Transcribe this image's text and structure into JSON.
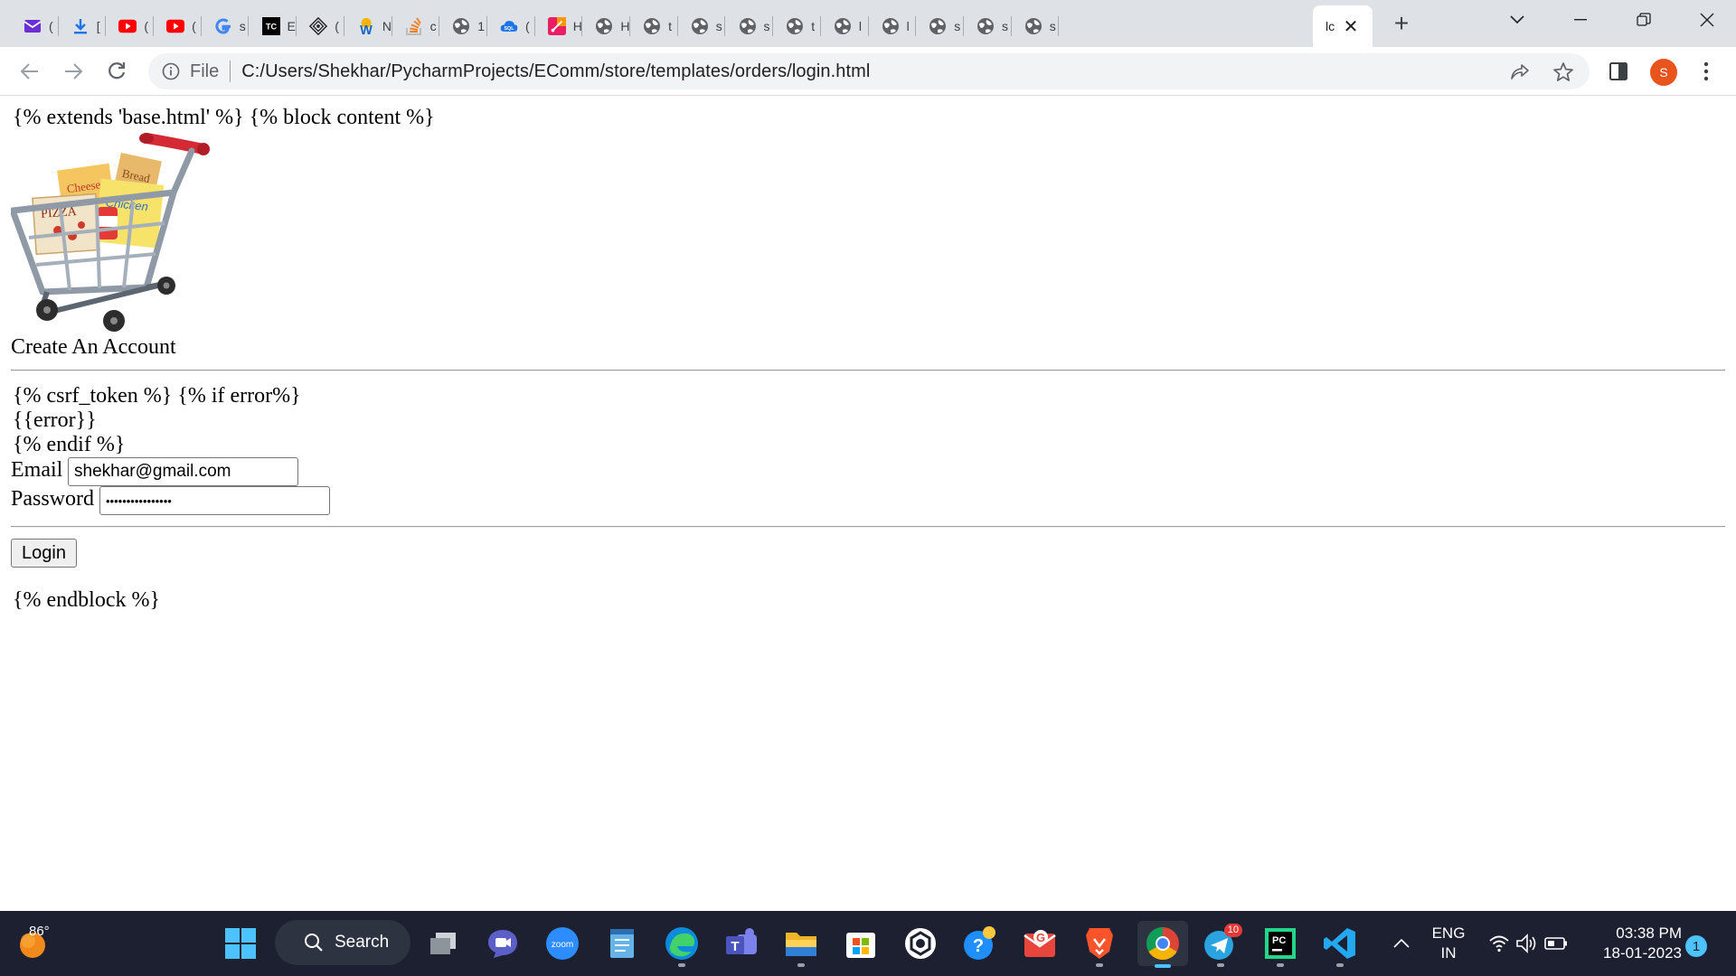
{
  "browser": {
    "tabs": [
      {
        "icon": "gmail-icon",
        "letter": "(",
        "color": "#6b2fd3"
      },
      {
        "icon": "download-icon",
        "letter": "[",
        "color": "#1a73e8"
      },
      {
        "icon": "youtube-icon",
        "letter": "(",
        "color": "#ff0000"
      },
      {
        "icon": "youtube-icon",
        "letter": "(",
        "color": "#ff0000"
      },
      {
        "icon": "google-icon",
        "letter": "s",
        "color": "#4285f4"
      },
      {
        "icon": "tc-icon",
        "letter": "E",
        "color": "#000000"
      },
      {
        "icon": "compass-icon",
        "letter": "(",
        "color": "#202124"
      },
      {
        "icon": "w-icon",
        "letter": "N",
        "color": "#f4b400"
      },
      {
        "icon": "stack-icon",
        "letter": "c",
        "color": "#f48024"
      },
      {
        "icon": "globe-icon",
        "letter": "1",
        "color": "#5f6368"
      },
      {
        "icon": "sql-icon",
        "letter": "(",
        "color": "#1a73e8"
      },
      {
        "icon": "pink-app-icon",
        "letter": "H",
        "color": "#e91e63"
      },
      {
        "icon": "globe-icon",
        "letter": "H",
        "color": "#5f6368"
      },
      {
        "icon": "globe-icon",
        "letter": "t",
        "color": "#5f6368"
      },
      {
        "icon": "globe-icon",
        "letter": "s",
        "color": "#5f6368"
      },
      {
        "icon": "globe-icon",
        "letter": "s",
        "color": "#5f6368"
      },
      {
        "icon": "globe-icon",
        "letter": "t",
        "color": "#5f6368"
      },
      {
        "icon": "globe-icon",
        "letter": "l",
        "color": "#5f6368"
      },
      {
        "icon": "globe-icon",
        "letter": "l",
        "color": "#5f6368"
      },
      {
        "icon": "globe-icon",
        "letter": "s",
        "color": "#5f6368"
      },
      {
        "icon": "globe-icon",
        "letter": "s",
        "color": "#5f6368"
      },
      {
        "icon": "globe-icon",
        "letter": "s",
        "color": "#5f6368"
      }
    ],
    "active_tab": {
      "label": "lc",
      "close": "✕"
    },
    "new_tab": "+",
    "omnibox": {
      "scheme_label": "File",
      "url": "C:/Users/Shekhar/PycharmProjects/EComm/store/templates/orders/login.html"
    },
    "profile_initial": "S"
  },
  "page": {
    "line_extends": "{% extends 'base.html' %}  {% block content %}",
    "heading": "Create An Account",
    "line_csrf": "{% csrf_token %}  {% if error%}",
    "line_error": "{{error}}",
    "line_endif": "{% endif %}",
    "email_label": "Email",
    "email_value": "shekhar@gmail.com",
    "password_label": "Password",
    "password_value": "••••••••••••••••",
    "login_button": "Login",
    "line_endblock": "{% endblock %}"
  },
  "taskbar": {
    "weather_temp": "86°",
    "search_label": "Search",
    "language_top": "ENG",
    "language_bottom": "IN",
    "time": "03:38 PM",
    "date": "18-01-2023",
    "notification_count": "1",
    "telegram_badge": "10"
  }
}
